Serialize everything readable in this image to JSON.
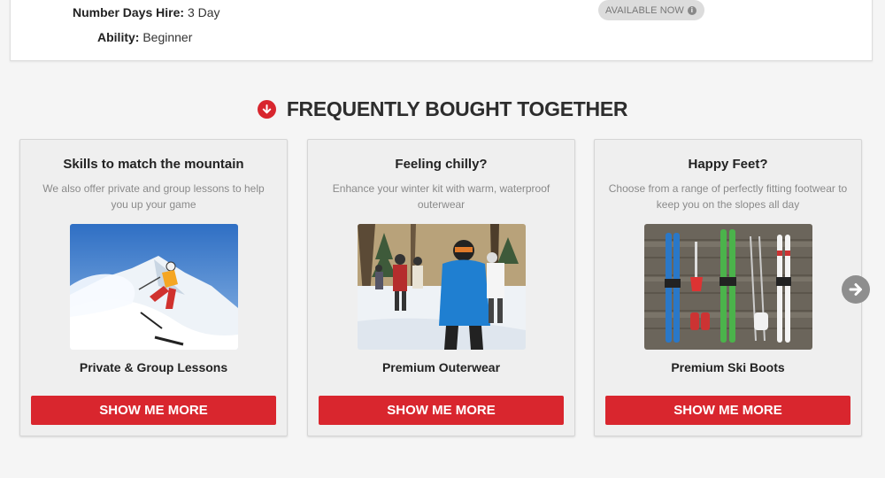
{
  "product_details": {
    "days_label": "Number Days Hire:",
    "days_value": "3 Day",
    "ability_label": "Ability:",
    "ability_value": "Beginner",
    "availability": "AVAILABLE NOW",
    "availability_icon": "info-icon"
  },
  "section": {
    "title": "FREQUENTLY BOUGHT TOGETHER",
    "icon": "arrow-down-circle-icon",
    "accent": "#d8262e"
  },
  "cards": [
    {
      "title": "Skills to match the mountain",
      "description": "We also offer private and group lessons to help you up your game",
      "image": "skier-carving-snow",
      "label": "Private & Group Lessons",
      "button": "SHOW ME MORE"
    },
    {
      "title": "Feeling chilly?",
      "description": "Enhance your winter kit with warm, waterproof outerwear",
      "image": "snowboarders-in-jackets",
      "label": "Premium Outerwear",
      "button": "SHOW ME MORE"
    },
    {
      "title": "Happy Feet?",
      "description": "Choose from a range of perfectly fitting footwear to keep you on the slopes all day",
      "image": "skis-and-gear-on-wood",
      "label": "Premium Ski Boots",
      "button": "SHOW ME MORE"
    }
  ],
  "carousel": {
    "next_icon": "arrow-right-circle-icon"
  },
  "colors": {
    "button_red": "#d9262e",
    "page_bg": "#f5f5f5",
    "card_bg": "#efefef"
  }
}
